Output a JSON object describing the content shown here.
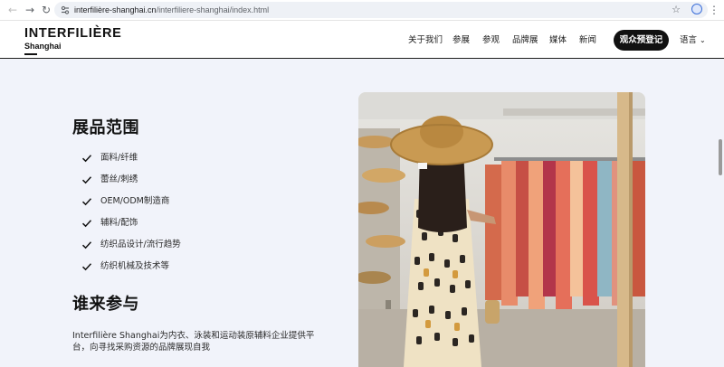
{
  "browser": {
    "url_host": "interfilière-shanghai.cn",
    "url_path": "/interfiliere-shanghai/index.html"
  },
  "header": {
    "logo_main": "INTERFILIÈRE",
    "logo_sub": "Shanghai",
    "nav": [
      "关于我们",
      "参展",
      "参观",
      "品牌展",
      "媒体",
      "新闻"
    ],
    "cta": "观众预登记",
    "language": "语言"
  },
  "scope": {
    "title": "展品范围",
    "items": [
      "面料/纤维",
      "蕾丝/刺绣",
      "OEM/ODM制造商",
      "辅料/配饰",
      "纺织品设计/流行趋势",
      "纺织机械及技术等"
    ]
  },
  "visitors": {
    "title": "谁来参与",
    "description": "Interfilière Shanghai为内衣、泳装和运动装原辅料企业提供平台，向寻找采购资源的品牌展现自我"
  },
  "colors": {
    "page_bg": "#f1f3fa",
    "cta_bg": "#111111",
    "text": "#1c1c1c"
  }
}
